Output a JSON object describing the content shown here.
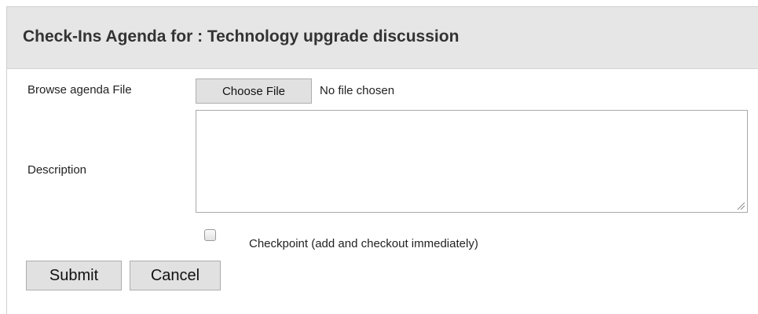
{
  "header": {
    "title": "Check-Ins Agenda for : Technology upgrade discussion"
  },
  "form": {
    "browse_label": "Browse agenda File",
    "choose_file_label": "Choose File",
    "file_status": "No file chosen",
    "description_label": "Description",
    "description_value": "",
    "checkpoint_checked": false,
    "checkpoint_label": "Checkpoint (add and checkout immediately)"
  },
  "actions": {
    "submit_label": "Submit",
    "cancel_label": "Cancel"
  },
  "icons": {
    "resize_grip": "resize-grip-icon"
  }
}
